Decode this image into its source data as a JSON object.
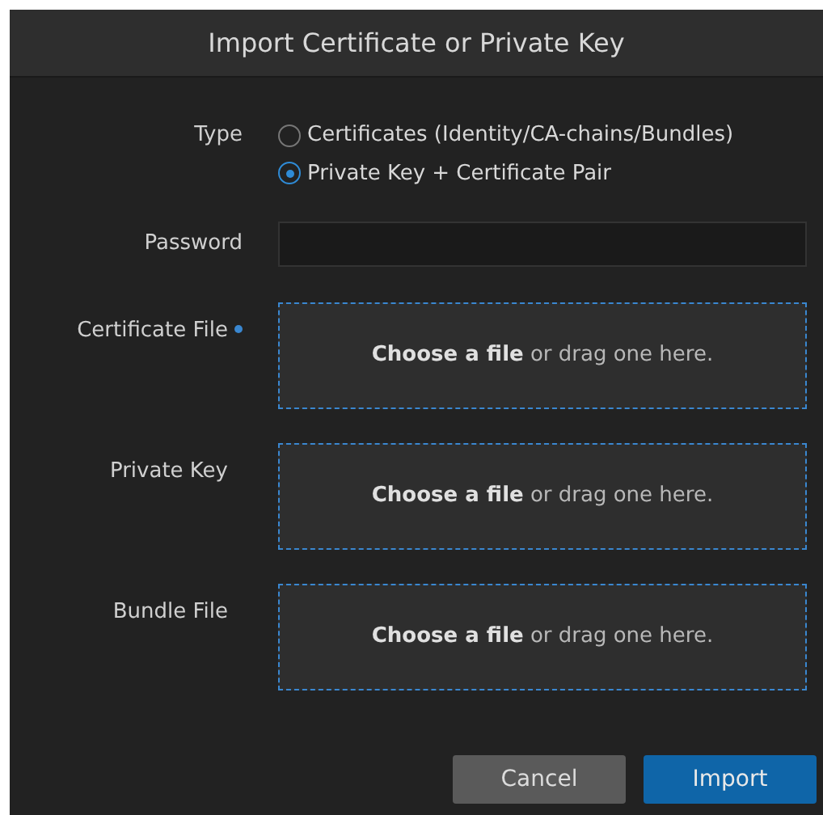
{
  "dialog": {
    "title": "Import Certificate or Private Key"
  },
  "type_field": {
    "label": "Type",
    "options": [
      {
        "label": "Certificates (Identity/CA-chains/Bundles)",
        "selected": false
      },
      {
        "label": "Private Key + Certificate Pair",
        "selected": true
      }
    ]
  },
  "password_field": {
    "label": "Password"
  },
  "file_fields": [
    {
      "label": "Certificate File",
      "required": true,
      "prompt": "**Choose a file** or drag one here."
    },
    {
      "label": "Private Key",
      "required": false,
      "prompt": "**Choose a file** or drag one here."
    },
    {
      "label": "Bundle File",
      "required": false,
      "prompt": "**Choose a file** or drag one here."
    }
  ],
  "buttons": [
    {
      "label": "Cancel",
      "kind": "secondary"
    },
    {
      "label": "Import",
      "kind": "primary"
    }
  ]
}
